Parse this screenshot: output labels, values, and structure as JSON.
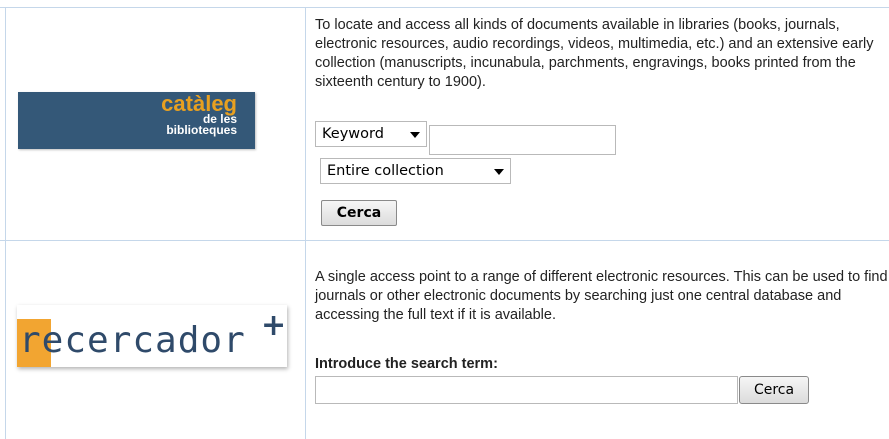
{
  "catalog": {
    "logo_main": "catàleg",
    "logo_sub1": "de les",
    "logo_sub2": "biblioteques",
    "description": "To locate and access all kinds of documents available in libraries (books, journals, electronic resources, audio recordings, videos, multimedia, etc.) and an extensive early collection (manuscripts, incunabula, parchments, engravings, books printed from the sixteenth century to 1900).",
    "search_type_selected": "Keyword",
    "search_input_value": "",
    "collection_selected": "Entire collection",
    "search_button": "Cerca"
  },
  "recercador": {
    "logo_re": "re",
    "logo_rest": "cercador",
    "logo_plus": "+",
    "description": "A single access point to a range of different electronic resources. This can be used to find journals or other electronic documents by searching just one central database and accessing the full text if it is available.",
    "search_label": "Introduce the search term:",
    "search_input_value": "",
    "search_button": "Cerca"
  },
  "colors": {
    "border": "#c5d7ea",
    "cataleg_bg": "#345878",
    "cataleg_accent": "#e8a020",
    "recercador_accent": "#f2a531",
    "recercador_text": "#2f4a6a"
  }
}
